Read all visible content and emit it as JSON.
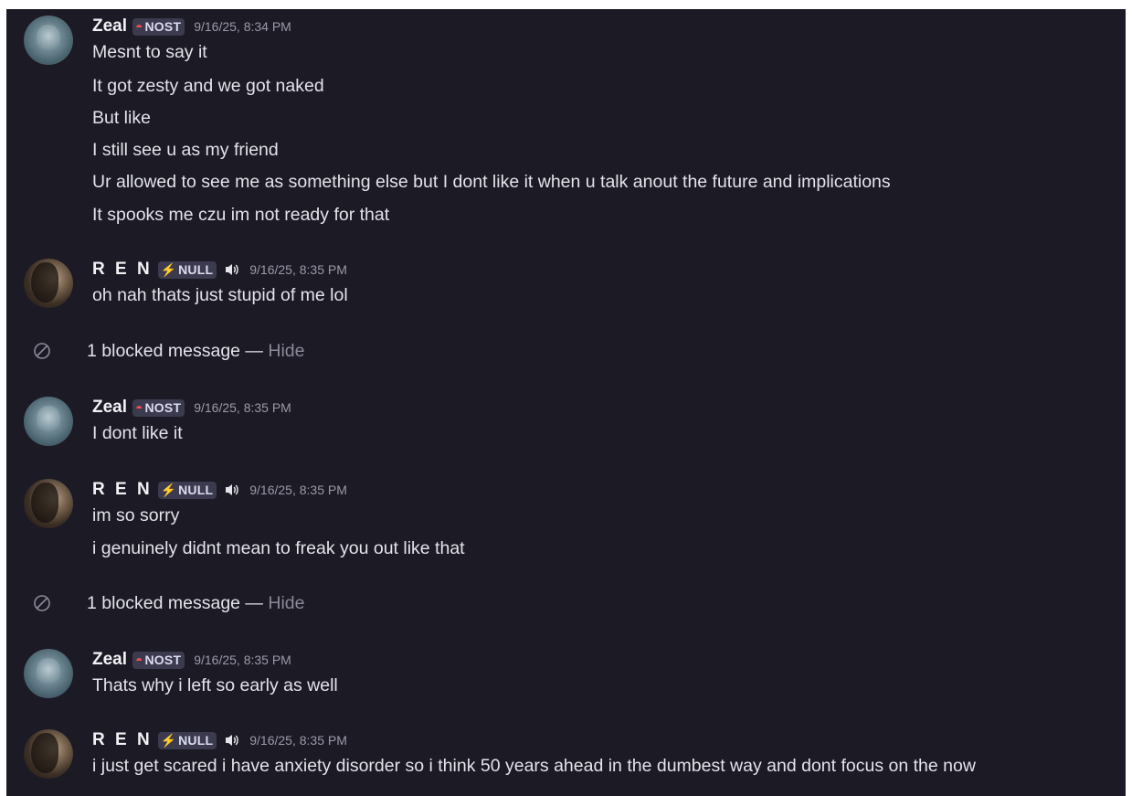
{
  "tags": {
    "nost": "NOST",
    "null": "NULL"
  },
  "users": {
    "zeal": "Zeal",
    "ren": "R E N"
  },
  "messages": [
    {
      "author": "Zeal",
      "timestamp": "9/16/25, 8:34 PM",
      "lines": [
        "Mesnt to say it",
        "It got zesty and we got naked",
        "But like",
        "I still see u as my friend",
        "Ur allowed to see me as something else but I dont like it when u talk anout the future and implications",
        "It spooks me czu im not ready for that"
      ]
    },
    {
      "author": "R E N",
      "timestamp": "9/16/25, 8:35 PM",
      "lines": [
        "oh nah thats just stupid of me lol"
      ]
    },
    {
      "author": "Zeal",
      "timestamp": "9/16/25, 8:35 PM",
      "lines": [
        "I dont like it"
      ]
    },
    {
      "author": "R E N",
      "timestamp": "9/16/25, 8:35 PM",
      "lines": [
        "im so sorry",
        "i genuinely didnt mean to freak you out like that"
      ]
    },
    {
      "author": "Zeal",
      "timestamp": "9/16/25, 8:35 PM",
      "lines": [
        "Thats why i left so early as well"
      ]
    },
    {
      "author": "R E N",
      "timestamp": "9/16/25, 8:35 PM",
      "lines": [
        "i just get scared i have anxiety disorder so i think 50 years ahead in the dumbest way and dont focus on the now"
      ]
    }
  ],
  "blocked": {
    "text": "1 blocked message —",
    "hide": "Hide"
  },
  "icons": {
    "avatar": "avatar-image",
    "nost_tag": "nost-role-icon",
    "null_tag": "lightning-icon",
    "speaker": "speaker-icon",
    "blocked": "blocked-icon"
  },
  "colors": {
    "background": "#1b1a25",
    "text": "#e3e3ea",
    "muted": "#9b9aa8",
    "tag_bg": "#3b3a4e",
    "nost_accent": "#f04d4d",
    "null_accent": "#f5c542"
  }
}
